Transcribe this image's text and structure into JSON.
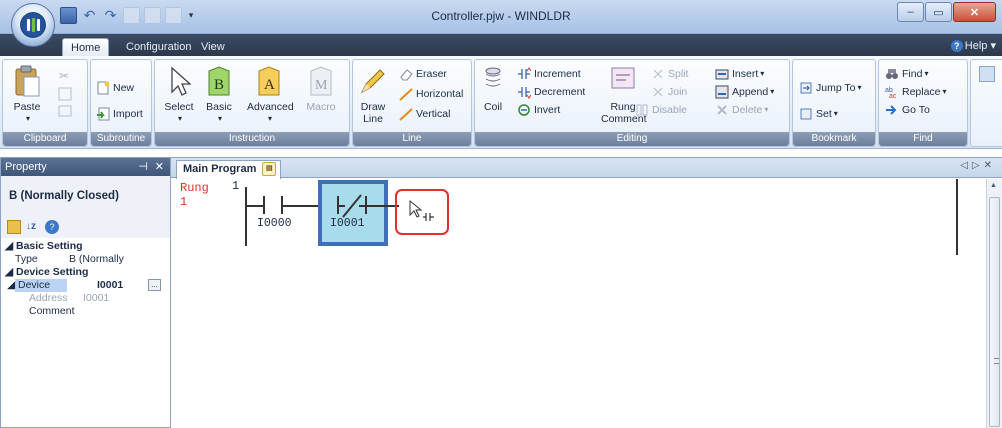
{
  "window": {
    "title": "Controller.pjw - WINDLDR"
  },
  "tabs": {
    "home": "Home",
    "configuration": "Configuration",
    "view": "View",
    "help": "Help"
  },
  "ribbon": {
    "clipboard": {
      "label": "Clipboard",
      "paste": "Paste"
    },
    "subroutine": {
      "label": "Subroutine",
      "new": "New",
      "import": "Import"
    },
    "instruction": {
      "label": "Instruction",
      "select": "Select",
      "basic": "Basic",
      "advanced": "Advanced",
      "macro": "Macro",
      "basic_glyph": "B",
      "advanced_glyph": "A",
      "macro_glyph": "M"
    },
    "line": {
      "label": "Line",
      "draw_line": "Draw Line",
      "eraser": "Eraser",
      "horizontal": "Horizontal",
      "vertical": "Vertical"
    },
    "editing": {
      "label": "Editing",
      "coil": "Coil",
      "increment": "Increment",
      "decrement": "Decrement",
      "invert": "Invert",
      "rung_comment": "Rung Comment",
      "split": "Split",
      "join": "Join",
      "disable": "Disable",
      "insert": "Insert",
      "append": "Append",
      "delete": "Delete"
    },
    "bookmark": {
      "label": "Bookmark",
      "jump_to": "Jump To",
      "set": "Set"
    },
    "find": {
      "label": "Find",
      "find": "Find",
      "replace": "Replace",
      "go_to": "Go To"
    }
  },
  "property_panel": {
    "header": "Property",
    "title": "B (Normally Closed)",
    "sections": {
      "basic": "Basic Setting",
      "type_key": "Type",
      "type_val": "B (Normally",
      "device_setting": "Device Setting",
      "device_key": "Device",
      "device_val": "I0001",
      "address_key": "Address",
      "address_val": "I0001",
      "comment_key": "Comment"
    }
  },
  "document": {
    "tab": "Main Program",
    "rung_label": "Rung",
    "rung_index": "1",
    "rung_number": "1",
    "contacts": [
      {
        "device": "I0000",
        "type": "normally-open"
      },
      {
        "device": "I0001",
        "type": "normally-closed",
        "selected": true
      }
    ]
  },
  "colors": {
    "accent": "#3f6fb4",
    "selection": "#a9dcea",
    "highlight_ring": "#e0302c",
    "rung_label": "#e0302c"
  }
}
